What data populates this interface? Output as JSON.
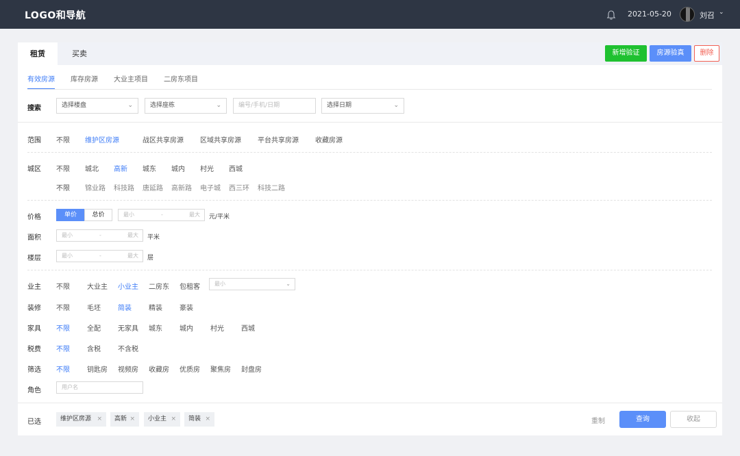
{
  "header": {
    "logo": "LOGO和导航",
    "date": "2021-05-20",
    "user_name": "刘召",
    "icons": [
      "bell-icon",
      "chevron-down-icon"
    ]
  },
  "tabs": {
    "main": [
      "租赁",
      "买卖"
    ],
    "active_main": "租赁",
    "sub": [
      "有效房源",
      "库存房源",
      "大业主项目",
      "二房东项目"
    ],
    "active_sub": "有效房源"
  },
  "actions": {
    "add_verify": "新增验证",
    "verify_listing": "房源验真",
    "delete": "删除"
  },
  "search": {
    "label": "搜索",
    "building_select": "选择楼盘",
    "block_select": "选择座栋",
    "keyword_placeholder": "编号/手机/日期",
    "date_select": "选择日期"
  },
  "scope": {
    "label": "范围",
    "options": [
      "不限",
      "维护区房源",
      "战区共享房源",
      "区域共享房源",
      "平台共享房源",
      "收藏房源"
    ],
    "selected": "维护区房源"
  },
  "district": {
    "label": "城区",
    "options": [
      "不限",
      "城北",
      "高新",
      "城东",
      "城内",
      "村光",
      "西城"
    ],
    "selected": "高新",
    "sub_options": [
      "不限",
      "锦业路",
      "科技路",
      "唐延路",
      "高新路",
      "电子城",
      "西三环",
      "科技二路"
    ]
  },
  "price": {
    "label": "价格",
    "modes": [
      "单价",
      "总价"
    ],
    "active_mode": "单价",
    "min_placeholder": "最小",
    "separator": "-",
    "max_placeholder": "最大",
    "unit": "元/平米"
  },
  "area": {
    "label": "面积",
    "min_placeholder": "最小",
    "separator": "-",
    "max_placeholder": "最大",
    "unit": "平米"
  },
  "floor": {
    "label": "楼层",
    "min_placeholder": "最小",
    "separator": "-",
    "max_placeholder": "最大",
    "unit": "层"
  },
  "owner": {
    "label": "业主",
    "options": [
      "不限",
      "大业主",
      "小业主",
      "二房东",
      "包租客"
    ],
    "selected": "小业主",
    "select_placeholder": "最小"
  },
  "decoration": {
    "label": "装修",
    "options": [
      "不限",
      "毛坯",
      "简装",
      "精装",
      "豪装"
    ],
    "selected": "简装"
  },
  "furniture": {
    "label": "家具",
    "options": [
      "不限",
      "全配",
      "无家具",
      "城东",
      "城内",
      "村光",
      "西城"
    ],
    "selected": "不限"
  },
  "tax": {
    "label": "税费",
    "options": [
      "不限",
      "含税",
      "不含税"
    ],
    "selected": "不限"
  },
  "filter": {
    "label": "筛选",
    "options": [
      "不限",
      "钥匙房",
      "视频房",
      "收藏房",
      "优质房",
      "聚焦房",
      "封盘房"
    ],
    "selected": "不限"
  },
  "role": {
    "label": "角色",
    "placeholder": "用户名"
  },
  "selected_tags": {
    "label": "已选",
    "tags": [
      "维护区房源",
      "高新",
      "小业主",
      "简装"
    ],
    "remove_glyph": "×"
  },
  "footer": {
    "reset": "重制",
    "query": "查询",
    "collapse": "收起"
  },
  "colors": {
    "header_bg": "#2e3644",
    "accent": "#5b8ff9",
    "active_text": "#3e7cf7",
    "green": "#1fc130",
    "red": "#f25f52"
  }
}
